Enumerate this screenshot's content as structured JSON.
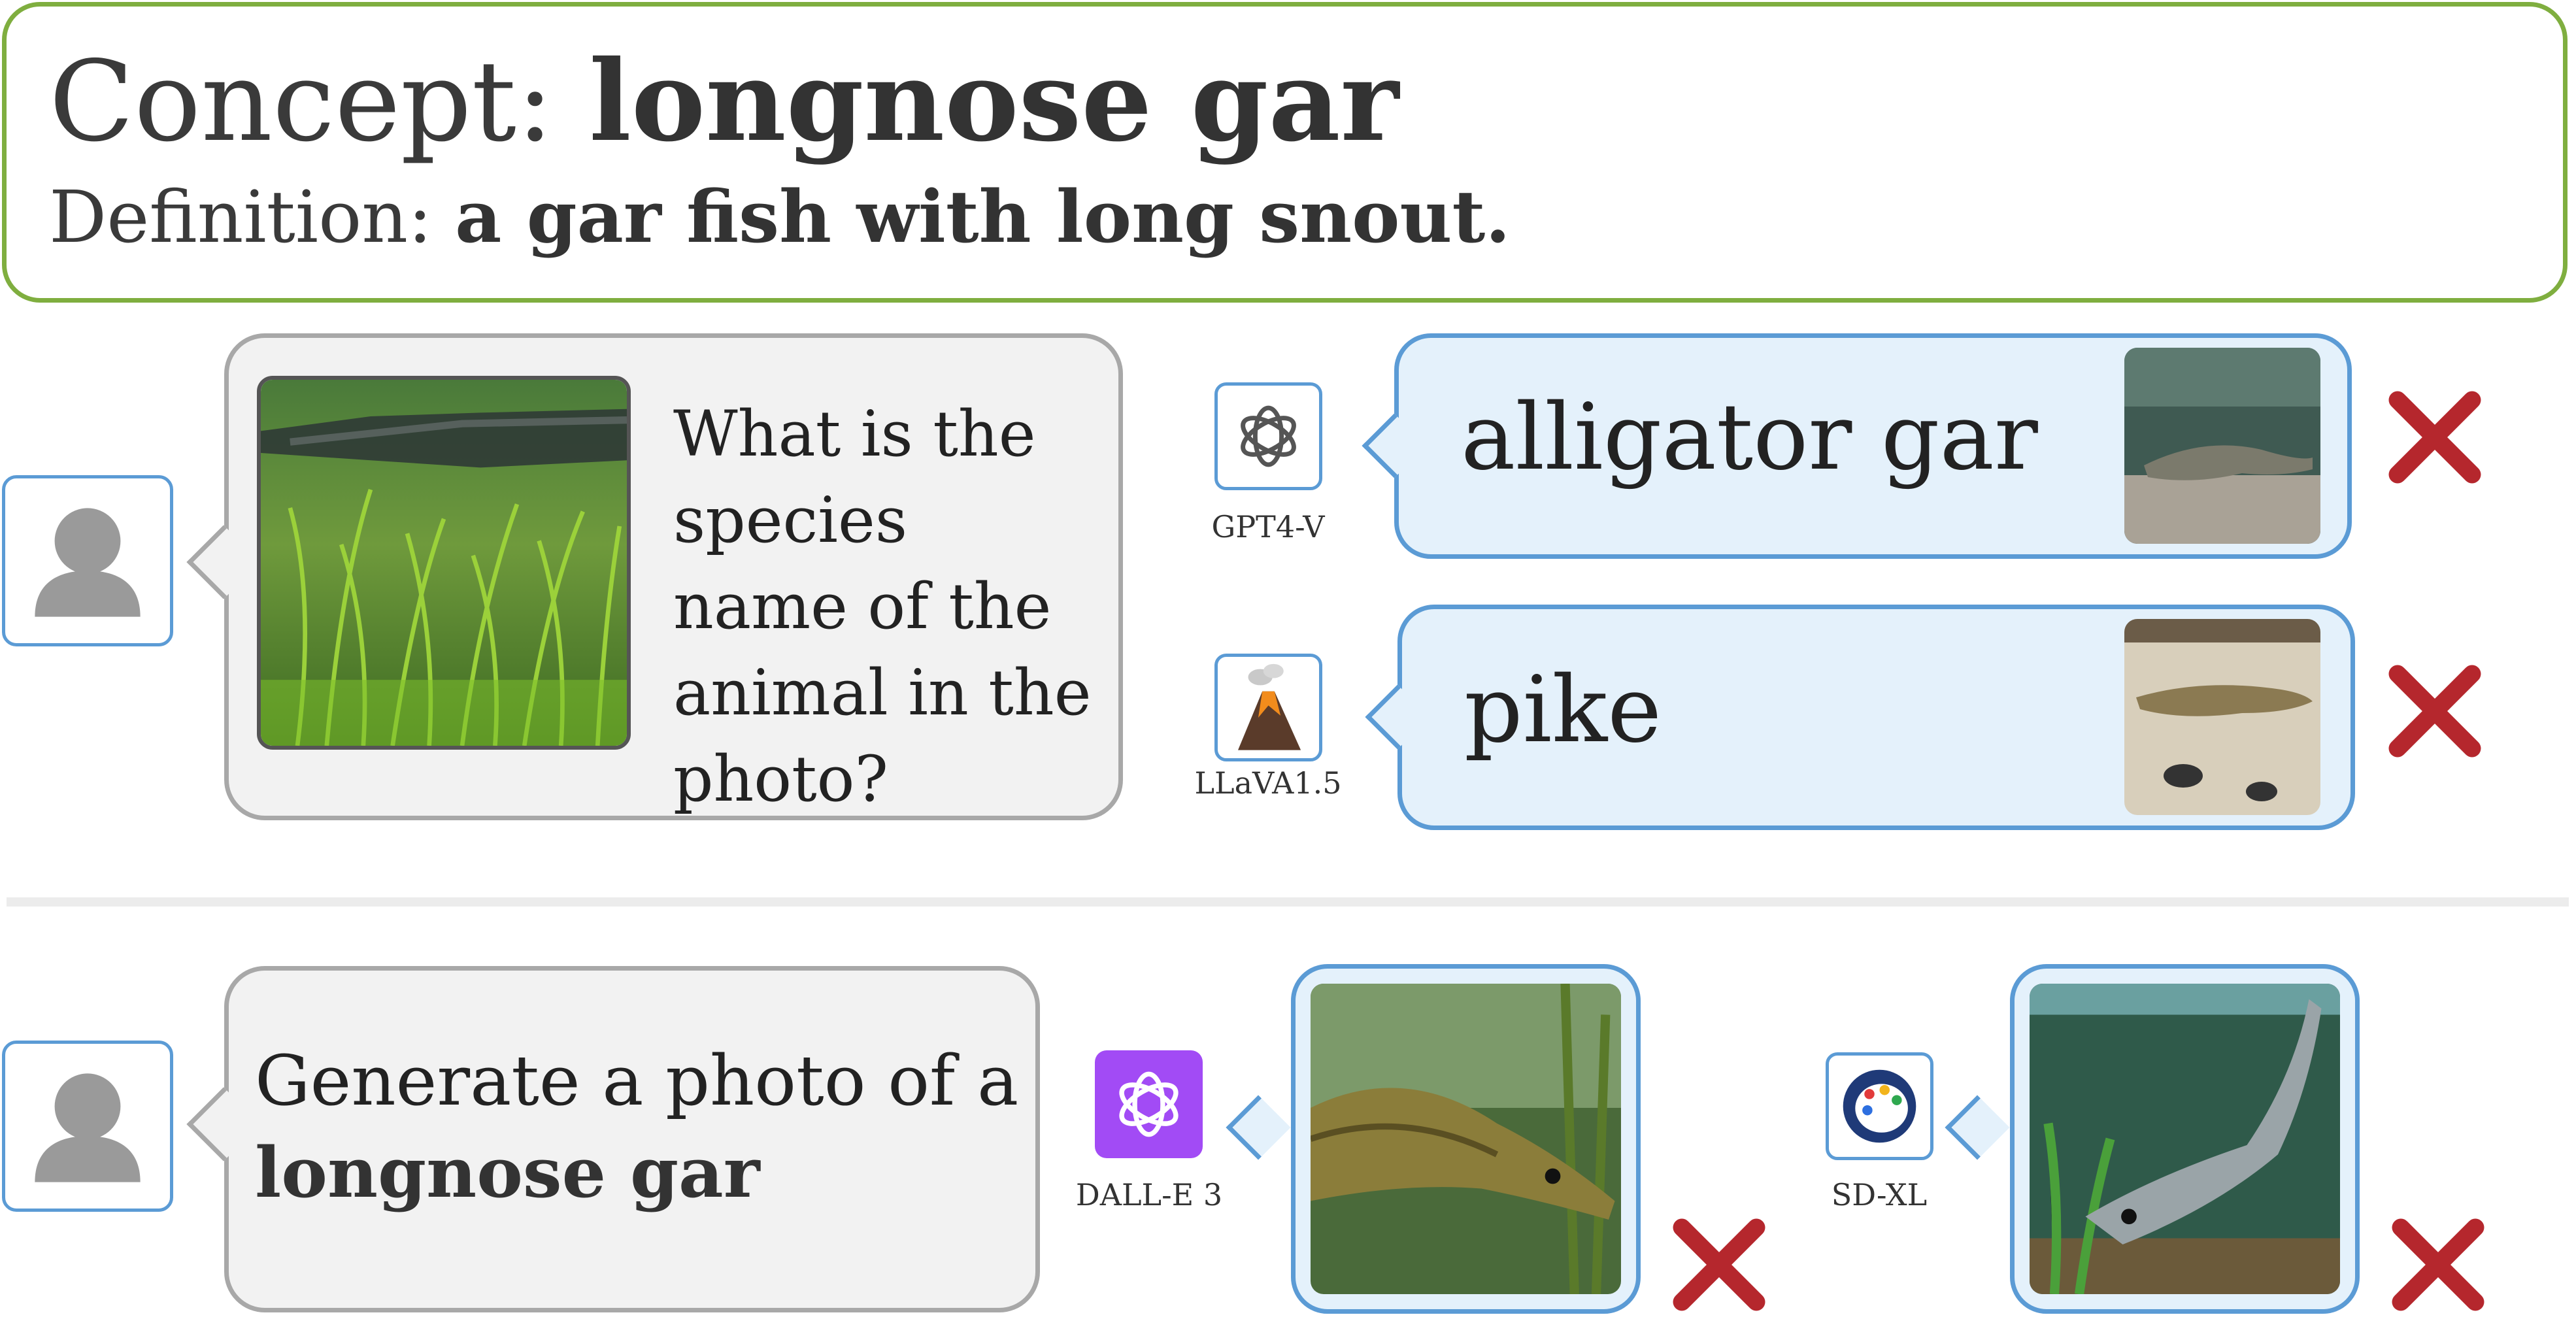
{
  "concept": {
    "label": "Concept:",
    "name": "longnose gar",
    "definition_label": "Definition:",
    "definition": "a gar fish with long snout."
  },
  "qa": {
    "question": "What is the species name of the animal in the photo?",
    "answers": [
      {
        "model": "GPT4-V",
        "answer": "alligator gar",
        "icon": "openai-logo-icon",
        "verdict": "wrong"
      },
      {
        "model": "LLaVA1.5",
        "answer": "pike",
        "icon": "volcano-icon",
        "verdict": "wrong"
      }
    ]
  },
  "generation": {
    "prompt_prefix": "Generate a photo of a",
    "prompt_concept": "longnose gar",
    "models": [
      {
        "model": "DALL-E 3",
        "icon": "openai-logo-icon",
        "verdict": "wrong"
      },
      {
        "model": "SD-XL",
        "icon": "palette-icon",
        "verdict": "wrong"
      }
    ]
  },
  "colors": {
    "concept_border": "#7fae3f",
    "answer_border": "#5b9bd5",
    "answer_fill": "#e4f1fb",
    "question_border": "#a8a8a8",
    "question_fill": "#f2f2f2",
    "wrong_mark": "#b5272d",
    "dalle_icon": "#a24bf5"
  }
}
